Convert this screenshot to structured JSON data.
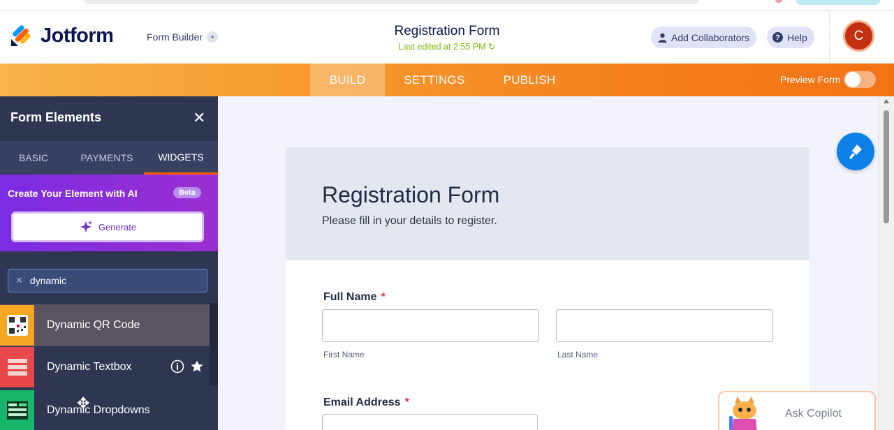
{
  "header": {
    "brand": "Jotform",
    "builder_menu": "Form Builder",
    "form_title": "Registration Form",
    "last_edited": "Last edited at 2:55 PM",
    "add_collaborators": "Add Collaborators",
    "help": "Help",
    "avatar_initial": "C"
  },
  "nav": {
    "tabs": [
      "BUILD",
      "SETTINGS",
      "PUBLISH"
    ],
    "active_tab": "BUILD",
    "preview_label": "Preview Form",
    "preview_on": false
  },
  "sidebar": {
    "title": "Form Elements",
    "tabs": [
      "BASIC",
      "PAYMENTS",
      "WIDGETS"
    ],
    "active_tab": "WIDGETS",
    "ai_title": "Create Your Element with AI",
    "beta_badge": "Beta",
    "generate_label": "Generate",
    "search_value": "dynamic",
    "items": [
      {
        "label": "Dynamic QR Code",
        "icon": "qr-code-icon"
      },
      {
        "label": "Dynamic Textbox",
        "icon": "textbox-icon"
      },
      {
        "label": "Dynamic Dropdowns",
        "icon": "dropdown-icon"
      }
    ]
  },
  "form": {
    "title": "Registration Form",
    "subtitle": "Please fill in your details to register.",
    "full_name_label": "Full Name",
    "first_name_sub": "First Name",
    "last_name_sub": "Last Name",
    "email_label": "Email Address",
    "required_mark": "*"
  },
  "copilot": {
    "label": "Ask Copilot"
  },
  "colors": {
    "brand_navy": "#0a1551",
    "nav_orange": "#f47d1b",
    "sidebar_bg": "#2f3652",
    "ai_purple": "#7b2ce2",
    "accent_blue": "#0b81e8",
    "required_red": "#e1323c",
    "edited_green": "#78bb07"
  }
}
